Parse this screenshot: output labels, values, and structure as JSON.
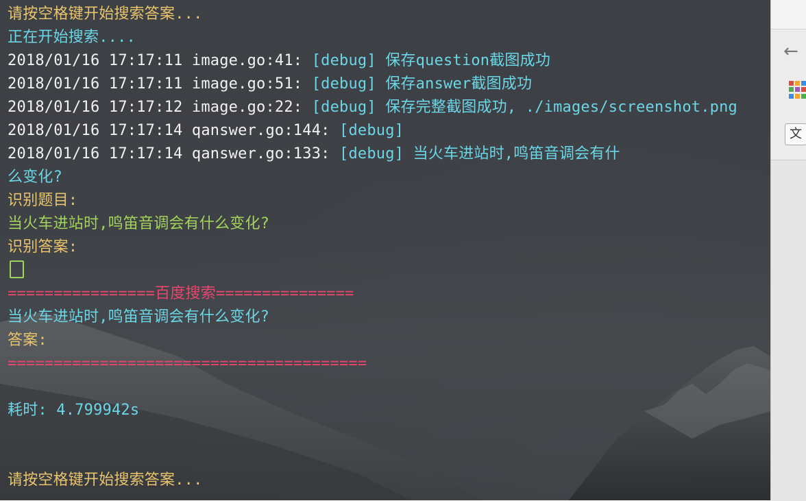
{
  "terminal": {
    "lines": [
      {
        "text": "请按空格键开始搜索答案..."
      },
      {
        "text": "正在开始搜索...."
      },
      {
        "prefix": "2018/01/16 17:17:11 image.go:41: ",
        "tag": "[debug]",
        "msg": " 保存question截图成功"
      },
      {
        "prefix": "2018/01/16 17:17:11 image.go:51: ",
        "tag": "[debug]",
        "msg": " 保存answer截图成功"
      },
      {
        "prefix": "2018/01/16 17:17:12 image.go:22: ",
        "tag": "[debug]",
        "msg": " 保存完整截图成功, ./images/screenshot.png"
      },
      {
        "prefix": "2018/01/16 17:17:14 qanswer.go:144: ",
        "tag": "[debug]"
      },
      {
        "prefix": "2018/01/16 17:17:14 qanswer.go:133: ",
        "tag": "[debug]",
        "msg": " 当火车进站时,鸣笛音调会有什"
      },
      {
        "text": "么变化?"
      },
      {
        "text": "识别题目:"
      },
      {
        "text": "当火车进站时,鸣笛音调会有什么变化?"
      },
      {
        "text": "识别答案:"
      },
      {
        "text": ""
      },
      {
        "left": "================",
        "center": "百度搜索",
        "right": "==============="
      },
      {
        "text": "当火车进站时,鸣笛音调会有什么变化?"
      },
      {
        "text": "答案:"
      },
      {
        "text": "======================================="
      },
      {
        "text": ""
      },
      {
        "label": "耗时: ",
        "value": "4.799942s"
      },
      {
        "text": ""
      },
      {
        "text": ""
      },
      {
        "text": "请按空格键开始搜索答案..."
      }
    ]
  },
  "colors": {
    "prompt": "#e8c46d",
    "info": "#6ad6e6",
    "log": "#f2f2f2",
    "question": "#a4d35c",
    "divider": "#e8466f"
  },
  "side_panel": {
    "icons": [
      "back-arrow-icon",
      "apps-grid-icon",
      "translate-icon"
    ],
    "translate_glyph": "文"
  }
}
